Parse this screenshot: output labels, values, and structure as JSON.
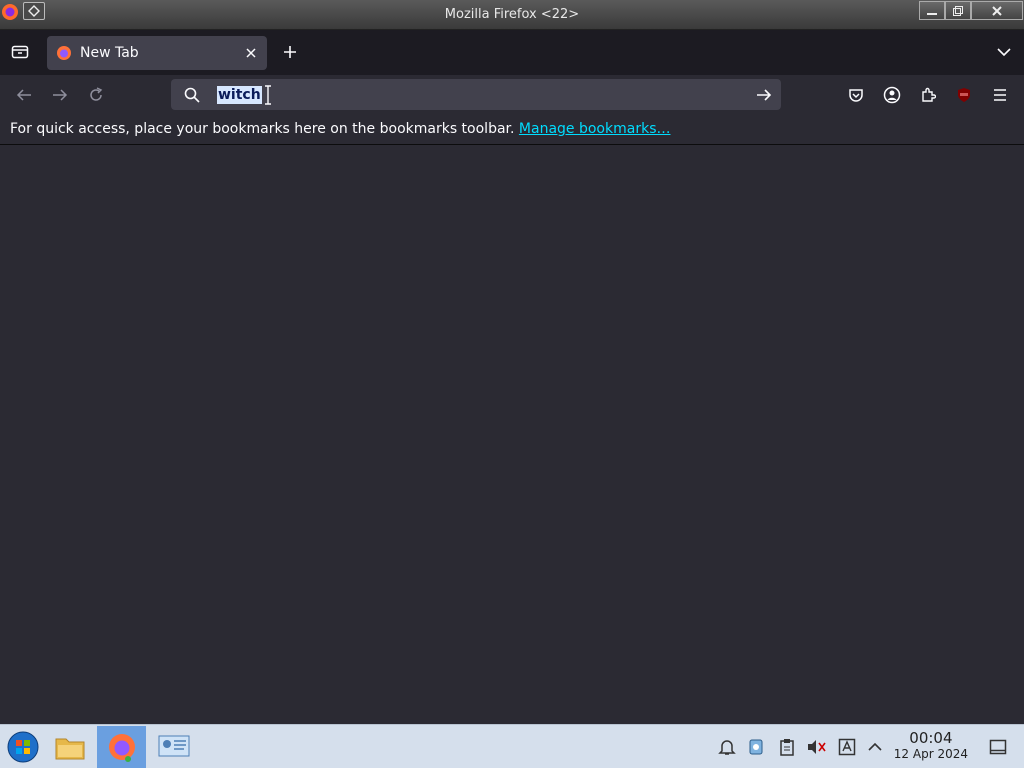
{
  "window": {
    "title": "Mozilla Firefox <22>"
  },
  "tabs": [
    {
      "label": "New Tab"
    }
  ],
  "urlbar": {
    "value": "witch"
  },
  "bookmarks_bar": {
    "message": "For quick access, place your bookmarks here on the bookmarks toolbar.",
    "link": "Manage bookmarks…"
  },
  "taskbar": {
    "clock": {
      "time": "00:04",
      "date": "12 Apr 2024"
    }
  },
  "colors": {
    "tab_active": "#42414d",
    "toolbar": "#2b2a33",
    "link": "#00ddff",
    "selection": "#d7e7ff"
  }
}
